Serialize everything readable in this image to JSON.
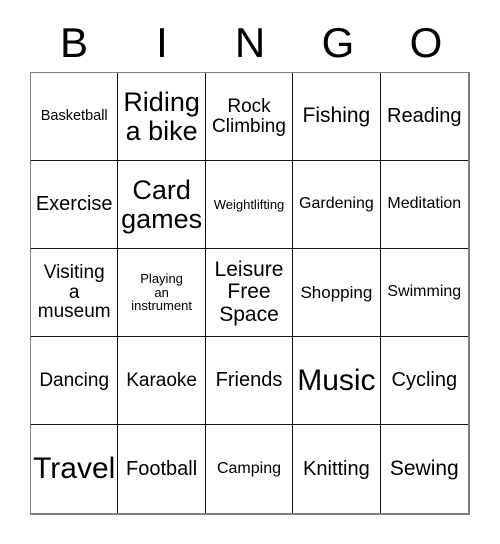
{
  "card": {
    "title": "BINGO",
    "headers": [
      "B",
      "I",
      "N",
      "G",
      "O"
    ],
    "free_space_label": "Leisure Free Space",
    "colors": {
      "background": "#ffffff",
      "text": "#000000",
      "cell_border": "#111111",
      "outer_border": "#808080"
    },
    "rows": [
      [
        {
          "text": "Basketball",
          "size": "fs-14",
          "free": false
        },
        {
          "text": "Riding\na bike",
          "size": "fs-27",
          "free": false
        },
        {
          "text": "Rock\nClimbing",
          "size": "fs-19",
          "free": false
        },
        {
          "text": "Fishing",
          "size": "fs-21",
          "free": false
        },
        {
          "text": "Reading",
          "size": "fs-20",
          "free": false
        }
      ],
      [
        {
          "text": "Exercise",
          "size": "fs-20",
          "free": false
        },
        {
          "text": "Card\ngames",
          "size": "fs-27",
          "free": false
        },
        {
          "text": "Weightlifting",
          "size": "fs-13",
          "free": false
        },
        {
          "text": "Gardening",
          "size": "fs-16",
          "free": false
        },
        {
          "text": "Meditation",
          "size": "fs-16",
          "free": false
        }
      ],
      [
        {
          "text": "Visiting\na\nmuseum",
          "size": "fs-19",
          "free": false
        },
        {
          "text": "Playing\nan\ninstrument",
          "size": "fs-13",
          "free": false
        },
        {
          "text": "Leisure\nFree\nSpace",
          "size": "fs-21",
          "free": true
        },
        {
          "text": "Shopping",
          "size": "fs-17",
          "free": false
        },
        {
          "text": "Swimming",
          "size": "fs-16",
          "free": false
        }
      ],
      [
        {
          "text": "Dancing",
          "size": "fs-19",
          "free": false
        },
        {
          "text": "Karaoke",
          "size": "fs-19",
          "free": false
        },
        {
          "text": "Friends",
          "size": "fs-20",
          "free": false
        },
        {
          "text": "Music",
          "size": "fs-30",
          "free": false
        },
        {
          "text": "Cycling",
          "size": "fs-20",
          "free": false
        }
      ],
      [
        {
          "text": "Travel",
          "size": "fs-30",
          "free": false
        },
        {
          "text": "Football",
          "size": "fs-20",
          "free": false
        },
        {
          "text": "Camping",
          "size": "fs-16",
          "free": false
        },
        {
          "text": "Knitting",
          "size": "fs-20",
          "free": false
        },
        {
          "text": "Sewing",
          "size": "fs-21",
          "free": false
        }
      ]
    ]
  }
}
